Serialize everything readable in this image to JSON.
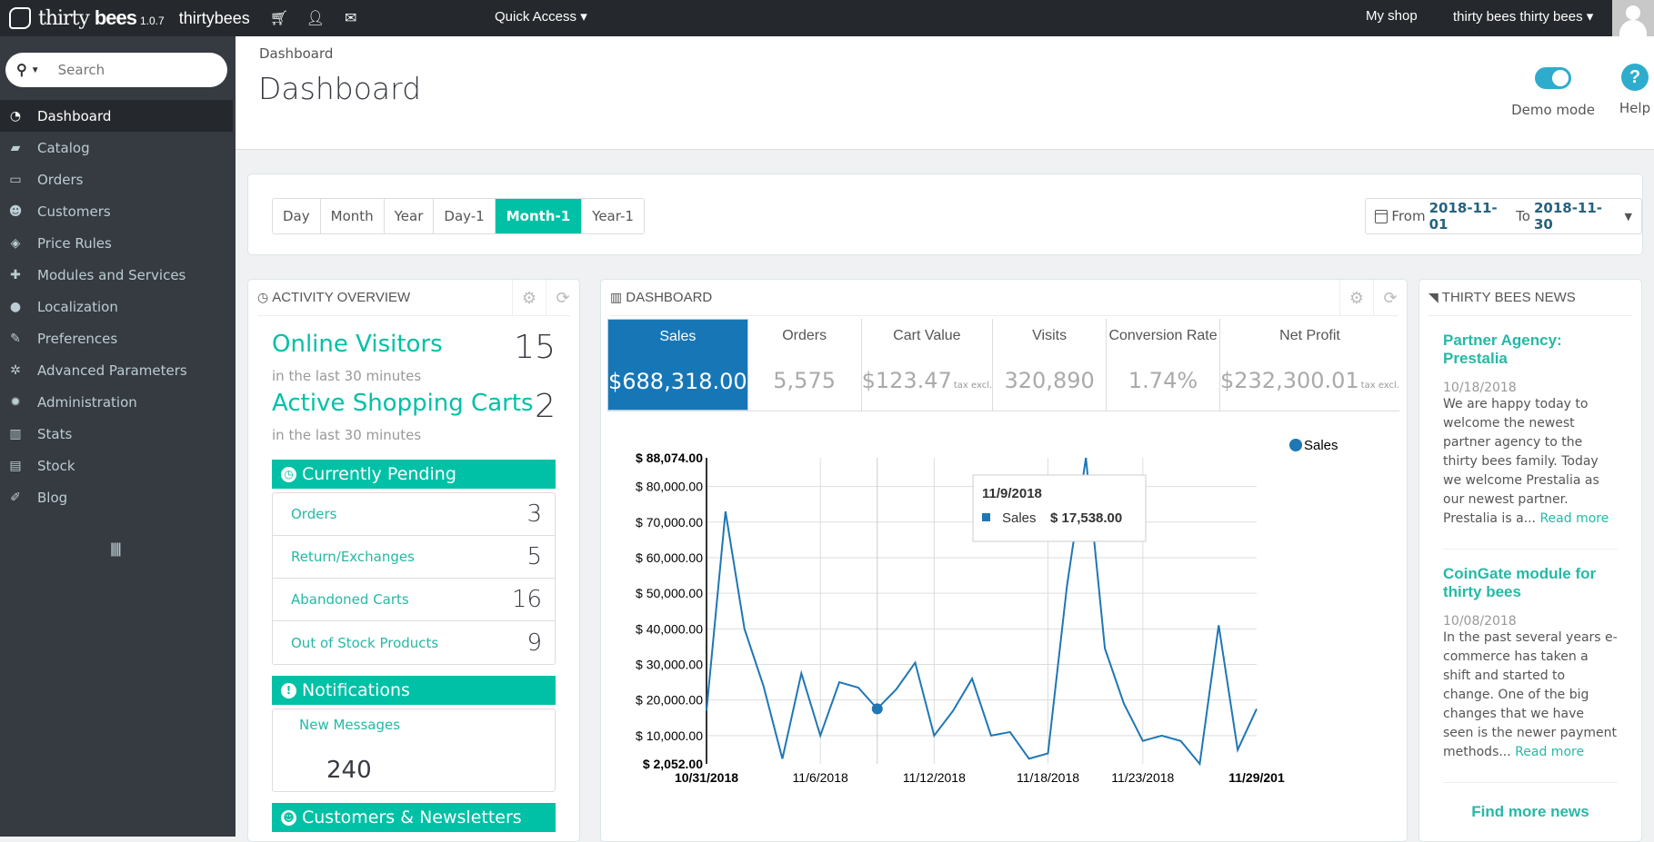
{
  "topbar": {
    "brand_light": "thirty",
    "brand_bold": "bees",
    "version": "1.0.7",
    "shop_name": "thirtybees",
    "quick_access": "Quick Access",
    "my_shop": "My shop",
    "user": "thirty bees thirty bees"
  },
  "sidebar": {
    "search_placeholder": "Search",
    "items": [
      {
        "label": "Dashboard",
        "icon": "dashboard-icon",
        "glyph": "◔"
      },
      {
        "label": "Catalog",
        "icon": "book-icon",
        "glyph": "▰"
      },
      {
        "label": "Orders",
        "icon": "credit-card-icon",
        "glyph": "▭"
      },
      {
        "label": "Customers",
        "icon": "users-icon",
        "glyph": "☻"
      },
      {
        "label": "Price Rules",
        "icon": "tags-icon",
        "glyph": "◈"
      },
      {
        "label": "Modules and Services",
        "icon": "puzzle-icon",
        "glyph": "✚"
      },
      {
        "label": "Localization",
        "icon": "globe-icon",
        "glyph": "●"
      },
      {
        "label": "Preferences",
        "icon": "wrench-icon",
        "glyph": "✎"
      },
      {
        "label": "Advanced Parameters",
        "icon": "cogs-icon",
        "glyph": "✲"
      },
      {
        "label": "Administration",
        "icon": "cog-icon",
        "glyph": "✹"
      },
      {
        "label": "Stats",
        "icon": "bar-chart-icon",
        "glyph": "▥"
      },
      {
        "label": "Stock",
        "icon": "archive-icon",
        "glyph": "▤"
      },
      {
        "label": "Blog",
        "icon": "edit-icon",
        "glyph": "✐"
      }
    ],
    "collapse_glyph": "|||||"
  },
  "header": {
    "breadcrumb": "Dashboard",
    "title": "Dashboard",
    "demo_mode_label": "Demo mode",
    "demo_mode_on": true,
    "help_label": "Help"
  },
  "filters": {
    "periods": [
      "Day",
      "Month",
      "Year",
      "Day-1",
      "Month-1",
      "Year-1"
    ],
    "active_period": "Month-1",
    "from_label": "From",
    "from": "2018-11-01",
    "to_label": "To",
    "to": "2018-11-30"
  },
  "activity": {
    "title": "Activity overview",
    "online_visitors": {
      "label": "Online Visitors",
      "sub": "in the last 30 minutes",
      "value": "15"
    },
    "active_carts": {
      "label": "Active Shopping Carts",
      "sub": "in the last 30 minutes",
      "value": "2"
    },
    "pending_title": "Currently Pending",
    "pending": [
      {
        "label": "Orders",
        "value": "3"
      },
      {
        "label": "Return/Exchanges",
        "value": "5"
      },
      {
        "label": "Abandoned Carts",
        "value": "16"
      },
      {
        "label": "Out of Stock Products",
        "value": "9"
      }
    ],
    "notifications_title": "Notifications",
    "new_messages_label": "New Messages",
    "new_messages_value": "240",
    "customers_title": "Customers & Newsletters"
  },
  "dashboard": {
    "title": "Dashboard",
    "tiles": [
      {
        "label": "Sales",
        "value": "$688,318.00",
        "suffix": ""
      },
      {
        "label": "Orders",
        "value": "5,575",
        "suffix": ""
      },
      {
        "label": "Cart Value",
        "value": "$123.47",
        "suffix": "tax excl."
      },
      {
        "label": "Visits",
        "value": "320,890",
        "suffix": ""
      },
      {
        "label": "Conversion Rate",
        "value": "1.74%",
        "suffix": ""
      },
      {
        "label": "Net Profit",
        "value": "$232,300.01",
        "suffix": "tax excl."
      }
    ],
    "active_tile": "Sales",
    "tooltip": {
      "date": "11/9/2018",
      "series": "Sales",
      "value": "$ 17,538.00"
    }
  },
  "chart_data": {
    "type": "line",
    "title": "",
    "xlabel": "",
    "ylabel": "",
    "legend": [
      "Sales"
    ],
    "legend_position": "top-right",
    "color": "#1f77b4",
    "x": [
      "10/31/2018",
      "11/1/2018",
      "11/2/2018",
      "11/3/2018",
      "11/4/2018",
      "11/5/2018",
      "11/6/2018",
      "11/7/2018",
      "11/8/2018",
      "11/9/2018",
      "11/10/2018",
      "11/11/2018",
      "11/12/2018",
      "11/13/2018",
      "11/14/2018",
      "11/15/2018",
      "11/16/2018",
      "11/17/2018",
      "11/18/2018",
      "11/19/2018",
      "11/20/2018",
      "11/21/2018",
      "11/22/2018",
      "11/23/2018",
      "11/24/2018",
      "11/25/2018",
      "11/26/2018",
      "11/27/2018",
      "11/28/2018",
      "11/29/2018"
    ],
    "series": [
      {
        "name": "Sales",
        "values": [
          17000,
          73000,
          40000,
          24000,
          3500,
          27500,
          10000,
          25000,
          23500,
          17538,
          23000,
          30500,
          10000,
          17000,
          26000,
          10000,
          11000,
          3500,
          5000,
          52000,
          88074,
          34500,
          19000,
          8500,
          10000,
          8500,
          2052,
          41000,
          6000,
          17500
        ]
      }
    ],
    "ylim": [
      2052,
      88074
    ],
    "yticks": [
      "$ 2,052.00",
      "$ 10,000.00",
      "$ 20,000.00",
      "$ 30,000.00",
      "$ 40,000.00",
      "$ 50,000.00",
      "$ 60,000.00",
      "$ 70,000.00",
      "$ 80,000.00",
      "$ 88,074.00"
    ],
    "ytick_values": [
      2052,
      10000,
      20000,
      30000,
      40000,
      50000,
      60000,
      70000,
      80000,
      88074
    ],
    "xticks": [
      "10/31/2018",
      "11/6/2018",
      "11/12/2018",
      "11/18/2018",
      "11/23/2018",
      "11/29/201"
    ],
    "xtick_index": [
      0,
      6,
      12,
      18,
      23,
      29
    ],
    "highlight_index": 9,
    "grid": true
  },
  "news": {
    "title": "Thirty bees news",
    "items": [
      {
        "title": "Partner Agency: Prestalia",
        "date": "10/18/2018",
        "body": "We are happy today to welcome the newest partner agency to the thirty bees family. Today we welcome Prestalia as our newest partner. Prestalia is a...",
        "read_more": "Read more"
      },
      {
        "title": "CoinGate module for thirty bees",
        "date": "10/08/2018",
        "body": "In the past several years e-commerce has taken a shift and started to change. One of the big changes that we have seen is the newer payment methods...",
        "read_more": "Read more"
      }
    ],
    "find_more": "Find more news"
  }
}
